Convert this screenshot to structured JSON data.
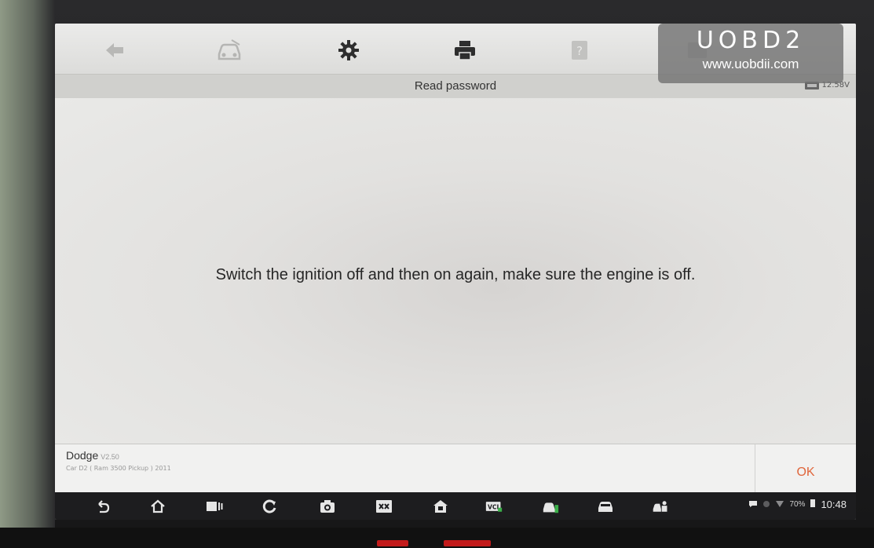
{
  "toolbar": {
    "icons": [
      "back-icon",
      "car-diagnostics-icon",
      "gear-icon",
      "printer-icon",
      "help-icon",
      "image-icon"
    ]
  },
  "header": {
    "title": "Read password",
    "voltage": "12.58V"
  },
  "main": {
    "message": "Switch the ignition off and then on again, make sure the engine is off."
  },
  "footer": {
    "vehicle_name": "Dodge",
    "vehicle_version": "V2.50",
    "vehicle_detail": "Car  D2 ( Ram 3500 Pickup ) 2011",
    "ok_label": "OK"
  },
  "navbar": {
    "icons": [
      "back-arrow-icon",
      "home-icon",
      "recent-apps-icon",
      "refresh-icon",
      "camera-icon",
      "screen-switch-icon",
      "home-shortcut-icon",
      "vci-icon",
      "car-check-icon",
      "car-icon",
      "car-service-icon"
    ],
    "battery": "70%",
    "time": "10:48"
  },
  "watermark": {
    "brand": "UOBD2",
    "url": "www.uobdii.com"
  },
  "colors": {
    "accent_ok": "#e0653a",
    "navbar_bg": "#1d1d1f",
    "screen_bg": "#e6e6e4"
  }
}
